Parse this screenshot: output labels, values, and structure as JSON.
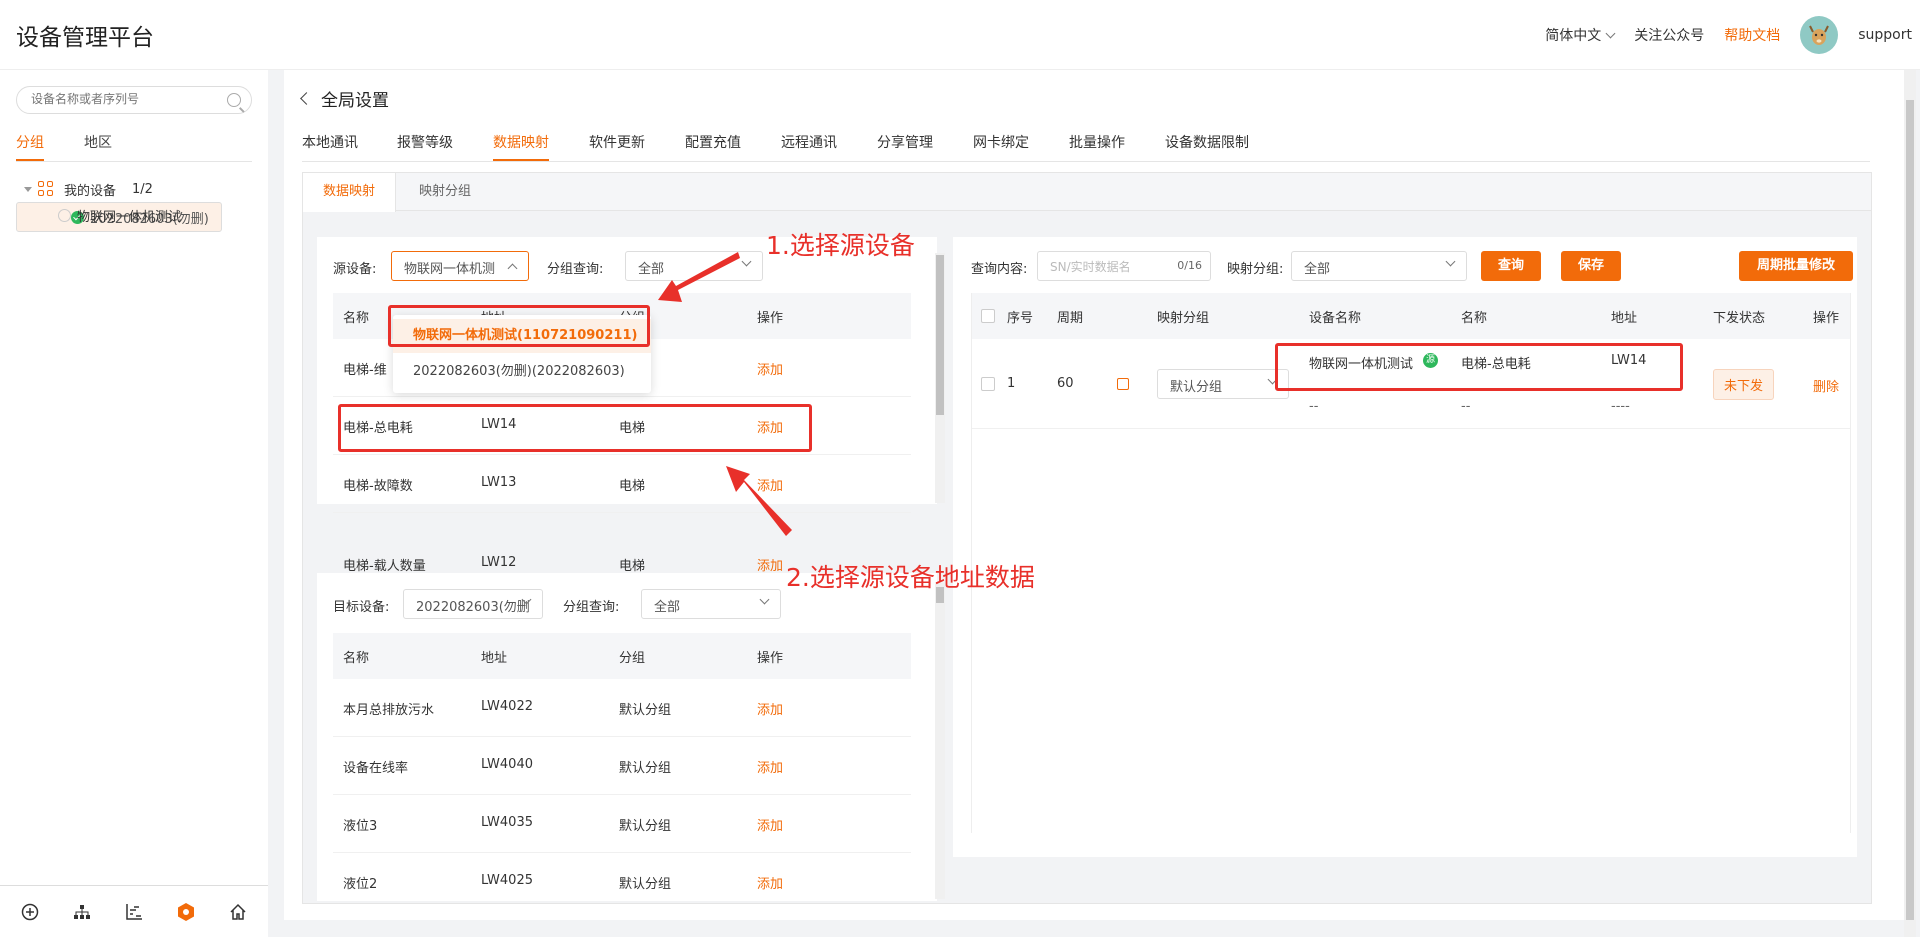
{
  "app": {
    "title": "设备管理平台"
  },
  "topbar": {
    "language": "简体中文",
    "follow": "关注公众号",
    "help": "帮助文档",
    "user": "support"
  },
  "sidebar": {
    "search_placeholder": "设备名称或者序列号",
    "tabs": [
      "分组",
      "地区"
    ],
    "tree": {
      "root_label": "我的设备",
      "root_count": "1/2",
      "devices": [
        "2022082603(勿删)",
        "物联网一体机测试"
      ]
    }
  },
  "page": {
    "back_title": "全局设置",
    "tabs": [
      "本地通讯",
      "报警等级",
      "数据映射",
      "软件更新",
      "配置充值",
      "远程通讯",
      "分享管理",
      "网卡绑定",
      "批量操作",
      "设备数据限制"
    ],
    "subtabs": [
      "数据映射",
      "映射分组"
    ]
  },
  "source": {
    "device_label": "源设备:",
    "device_value": "物联网一体机测",
    "group_label": "分组查询:",
    "group_value": "全部",
    "columns": [
      "名称",
      "地址",
      "分组",
      "操作"
    ],
    "dropdown": [
      "物联网一体机测试(110721090211)",
      "2022082603(勿删)(2022082603)"
    ],
    "rows": [
      {
        "name": "电梯-维",
        "addr": "",
        "group": "电梯",
        "op": "添加"
      },
      {
        "name": "电梯-总电耗",
        "addr": "LW14",
        "group": "电梯",
        "op": "添加"
      },
      {
        "name": "电梯-故障数",
        "addr": "LW13",
        "group": "电梯",
        "op": "添加"
      },
      {
        "name": "电梯-载人数量",
        "addr": "LW12",
        "group": "电梯",
        "op": "添加"
      }
    ]
  },
  "target": {
    "device_label": "目标设备:",
    "device_value": "2022082603(勿删",
    "group_label": "分组查询:",
    "group_value": "全部",
    "columns": [
      "名称",
      "地址",
      "分组",
      "操作"
    ],
    "rows": [
      {
        "name": "本月总排放污水",
        "addr": "LW4022",
        "group": "默认分组",
        "op": "添加"
      },
      {
        "name": "设备在线率",
        "addr": "LW4040",
        "group": "默认分组",
        "op": "添加"
      },
      {
        "name": "液位3",
        "addr": "LW4035",
        "group": "默认分组",
        "op": "添加"
      },
      {
        "name": "液位2",
        "addr": "LW4025",
        "group": "默认分组",
        "op": "添加"
      }
    ]
  },
  "mapping": {
    "query_label": "查询内容:",
    "query_placeholder": "SN/实时数据名",
    "query_count": "0/16",
    "group_label": "映射分组:",
    "group_value": "全部",
    "btn_query": "查询",
    "btn_save": "保存",
    "btn_batch": "周期批量修改",
    "columns": [
      "序号",
      "周期",
      "映射分组",
      "设备名称",
      "名称",
      "地址",
      "下发状态",
      "操作"
    ],
    "row": {
      "index": "1",
      "period": "60",
      "group": "默认分组",
      "src_device": "物联网一体机测试",
      "src_badge": "源",
      "src_name": "电梯-总电耗",
      "src_addr": "LW14",
      "dst_device": "--",
      "dst_name": "--",
      "dst_addr": "----",
      "status": "未下发",
      "op": "删除"
    }
  },
  "annotations": {
    "step1": "1.选择源设备",
    "step2": "2.选择源设备地址数据"
  },
  "colors": {
    "accent": "#f26b0a",
    "annotation": "#e8302a",
    "online": "#2eb85c"
  }
}
